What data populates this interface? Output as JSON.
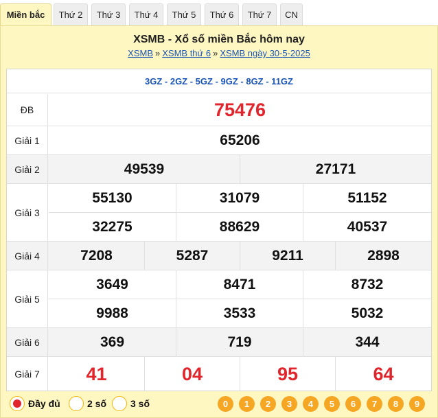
{
  "tabs": [
    {
      "label": "Miền bắc",
      "active": true
    },
    {
      "label": "Thứ 2"
    },
    {
      "label": "Thứ 3"
    },
    {
      "label": "Thứ 4"
    },
    {
      "label": "Thứ 5"
    },
    {
      "label": "Thứ 6"
    },
    {
      "label": "Thứ 7"
    },
    {
      "label": "CN"
    }
  ],
  "header": {
    "title": "XSMB - Xổ số miền Bắc hôm nay",
    "breadcrumb": [
      "XSMB",
      "XSMB thứ 6",
      "XSMB ngày 30-5-2025"
    ],
    "separator": "»"
  },
  "codes": "3GZ - 2GZ - 5GZ - 9GZ - 8GZ - 11GZ",
  "prizes": {
    "db": {
      "label": "ĐB",
      "values": [
        "75476"
      ]
    },
    "g1": {
      "label": "Giải 1",
      "values": [
        "65206"
      ]
    },
    "g2": {
      "label": "Giải 2",
      "values": [
        "49539",
        "27171"
      ]
    },
    "g3": {
      "label": "Giải 3",
      "values": [
        "55130",
        "31079",
        "51152",
        "32275",
        "88629",
        "40537"
      ]
    },
    "g4": {
      "label": "Giải 4",
      "values": [
        "7208",
        "5287",
        "9211",
        "2898"
      ]
    },
    "g5": {
      "label": "Giải 5",
      "values": [
        "3649",
        "8471",
        "8732",
        "9988",
        "3533",
        "5032"
      ]
    },
    "g6": {
      "label": "Giải 6",
      "values": [
        "369",
        "719",
        "344"
      ]
    },
    "g7": {
      "label": "Giải 7",
      "values": [
        "41",
        "04",
        "95",
        "64"
      ]
    }
  },
  "colors": {
    "highlight": "#e0262c",
    "link": "#1a55b5",
    "digit_bg": "#f5a623",
    "panel_bg": "#fff7c2"
  },
  "display_options": [
    {
      "label": "Đầy đủ",
      "selected": true
    },
    {
      "label": "2 số",
      "selected": false
    },
    {
      "label": "3 số",
      "selected": false
    }
  ],
  "digits": [
    "0",
    "1",
    "2",
    "3",
    "4",
    "5",
    "6",
    "7",
    "8",
    "9"
  ]
}
